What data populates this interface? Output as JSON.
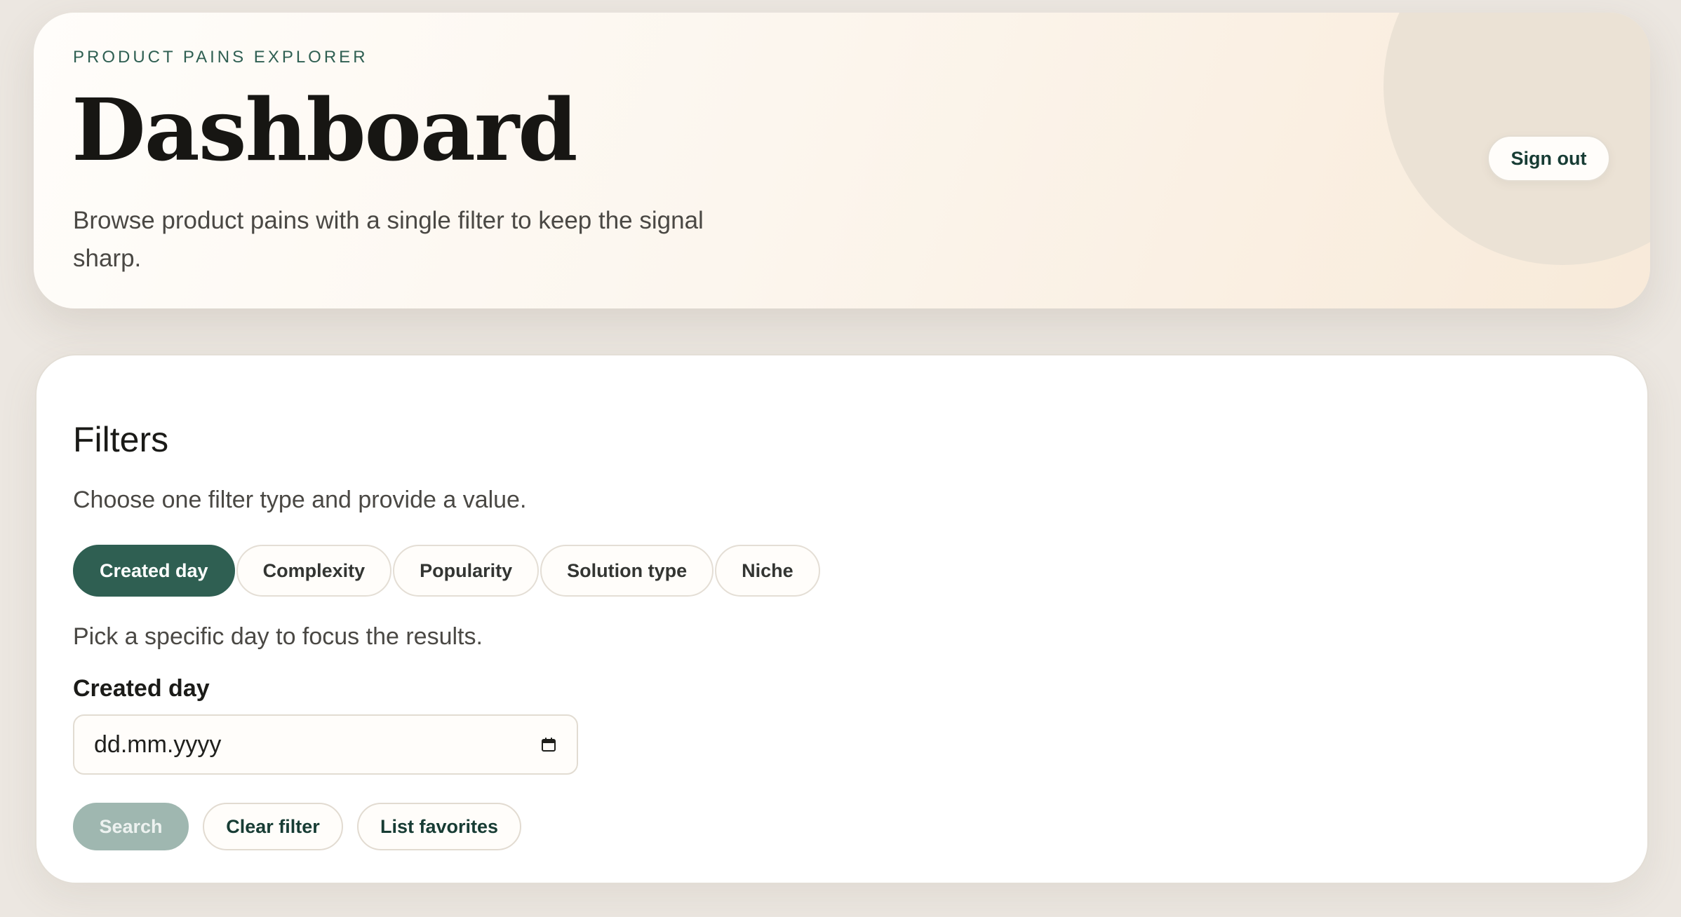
{
  "hero": {
    "eyebrow": "PRODUCT PAINS EXPLORER",
    "title": "Dashboard",
    "subtitle": "Browse product pains with a single filter to keep the signal sharp.",
    "sign_out_label": "Sign out"
  },
  "filters": {
    "heading": "Filters",
    "help": "Choose one filter type and provide a value.",
    "tabs": [
      {
        "label": "Created day",
        "selected": true
      },
      {
        "label": "Complexity",
        "selected": false
      },
      {
        "label": "Popularity",
        "selected": false
      },
      {
        "label": "Solution type",
        "selected": false
      },
      {
        "label": "Niche",
        "selected": false
      }
    ],
    "active_description": "Pick a specific day to focus the results.",
    "field": {
      "label": "Created day",
      "value": "",
      "placeholder": "dd.mm.yyyy",
      "icon": "calendar-icon"
    },
    "actions": {
      "search_label": "Search",
      "clear_label": "Clear filter",
      "favorites_label": "List favorites"
    }
  },
  "colors": {
    "accent": "#2f5f52",
    "disabled_accent": "#9fb7b0",
    "hero_circle": "#ebe2d5"
  }
}
